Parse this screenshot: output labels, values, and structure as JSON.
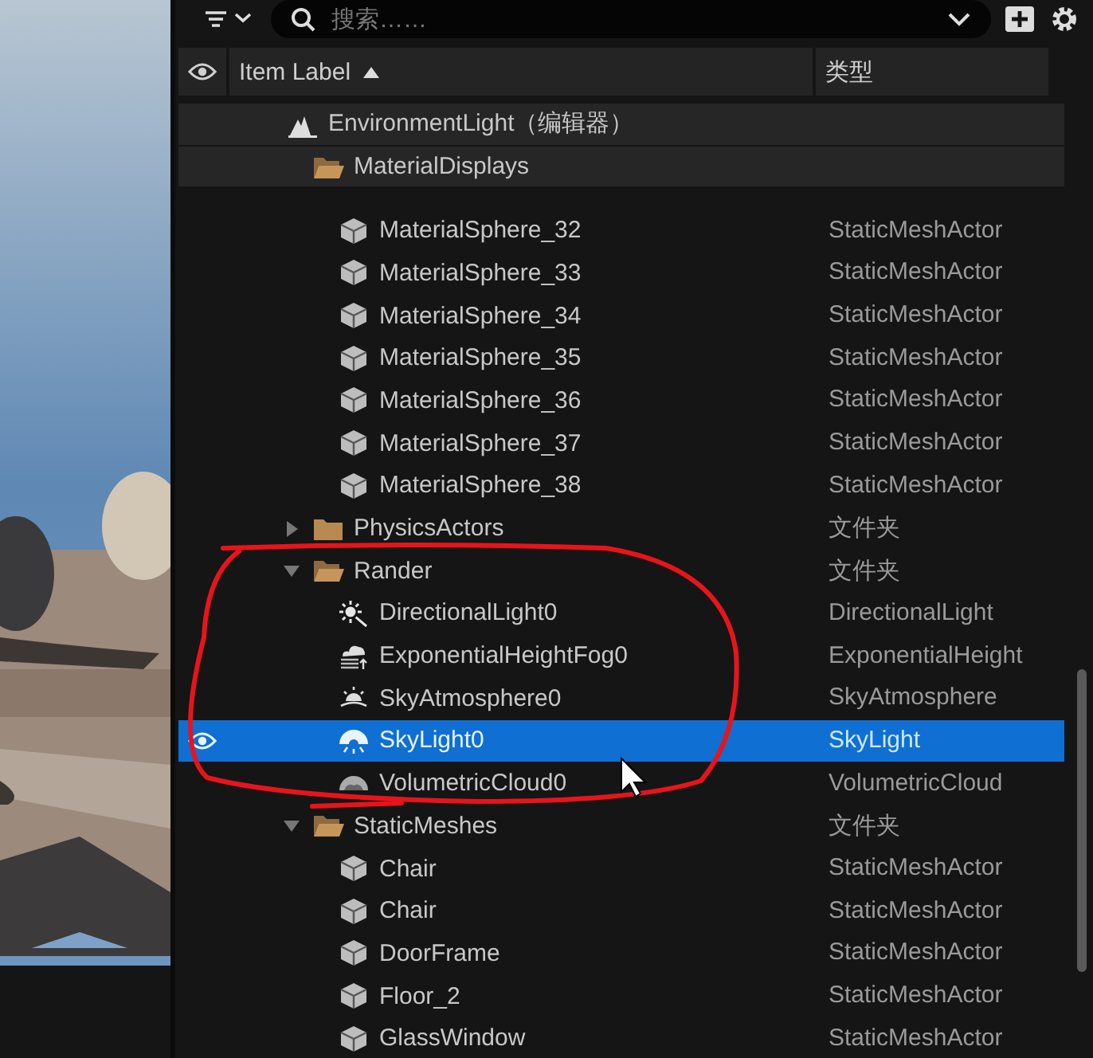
{
  "toolbar": {
    "search": {
      "placeholder": "搜索……"
    }
  },
  "header": {
    "columns": [
      {
        "label": "Item Label",
        "sorted": true
      },
      {
        "label": "类型",
        "sorted": false
      }
    ]
  },
  "tree": [
    {
      "label": "EnvironmentLight（编辑器）",
      "kind": "root",
      "pinned": true,
      "selected": false,
      "children": [
        {
          "label": "MaterialDisplays",
          "kind": "folder",
          "pinned": true,
          "selected": false,
          "children": [
            {
              "label": "MaterialSphere_32",
              "kind": "mesh",
              "type": "StaticMeshActor",
              "selected": false
            },
            {
              "label": "MaterialSphere_33",
              "kind": "mesh",
              "type": "StaticMeshActor",
              "selected": false
            },
            {
              "label": "MaterialSphere_34",
              "kind": "mesh",
              "type": "StaticMeshActor",
              "selected": false
            },
            {
              "label": "MaterialSphere_35",
              "kind": "mesh",
              "type": "StaticMeshActor",
              "selected": false
            },
            {
              "label": "MaterialSphere_36",
              "kind": "mesh",
              "type": "StaticMeshActor",
              "selected": false
            },
            {
              "label": "MaterialSphere_37",
              "kind": "mesh",
              "type": "StaticMeshActor",
              "selected": false
            },
            {
              "label": "MaterialSphere_38",
              "kind": "mesh",
              "type": "StaticMeshActor",
              "selected": false
            }
          ]
        },
        {
          "label": "PhysicsActors",
          "kind": "folder",
          "type": "文件夹",
          "expanded": false,
          "selected": false
        },
        {
          "label": "Rander",
          "kind": "folder",
          "type": "文件夹",
          "expanded": true,
          "selected": false,
          "children": [
            {
              "label": "DirectionalLight0",
              "kind": "directional-light",
              "type": "DirectionalLight",
              "selected": false
            },
            {
              "label": "ExponentialHeightFog0",
              "kind": "fog",
              "type": "ExponentialHeight",
              "selected": false
            },
            {
              "label": "SkyAtmosphere0",
              "kind": "atmosphere",
              "type": "SkyAtmosphere",
              "selected": false
            },
            {
              "label": "SkyLight0",
              "kind": "sky-light",
              "type": "SkyLight",
              "selected": true
            },
            {
              "label": "VolumetricCloud0",
              "kind": "cloud",
              "type": "VolumetricCloud",
              "selected": false
            }
          ]
        },
        {
          "label": "StaticMeshes",
          "kind": "folder",
          "type": "文件夹",
          "expanded": true,
          "selected": false,
          "children": [
            {
              "label": "Chair",
              "kind": "mesh",
              "type": "StaticMeshActor",
              "selected": false
            },
            {
              "label": "Chair",
              "kind": "mesh",
              "type": "StaticMeshActor",
              "selected": false
            },
            {
              "label": "DoorFrame",
              "kind": "mesh",
              "type": "StaticMeshActor",
              "selected": false
            },
            {
              "label": "Floor_2",
              "kind": "mesh",
              "type": "StaticMeshActor",
              "selected": false
            },
            {
              "label": "GlassWindow",
              "kind": "mesh",
              "type": "StaticMeshActor",
              "selected": false
            }
          ]
        }
      ]
    }
  ]
}
